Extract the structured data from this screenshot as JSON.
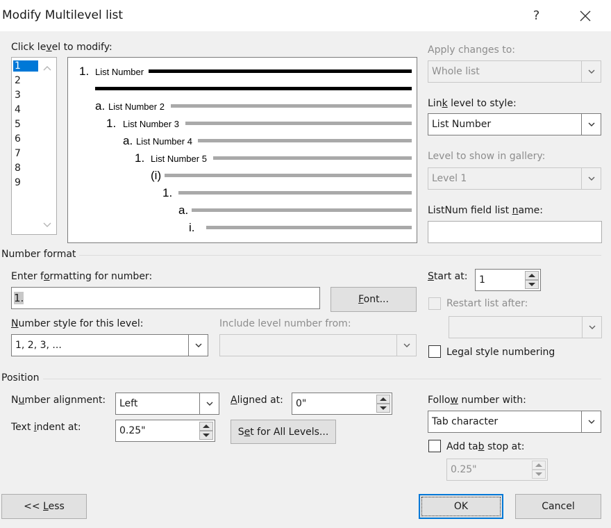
{
  "window": {
    "title": "Modify Multilevel list",
    "help": "?",
    "close": "✕"
  },
  "level_section": {
    "label": "Click level to modify:",
    "levels": [
      "1",
      "2",
      "3",
      "4",
      "5",
      "6",
      "7",
      "8",
      "9"
    ],
    "selected": "1"
  },
  "preview": {
    "items": [
      {
        "num": "1.",
        "text": "List Number"
      },
      {
        "num": "a.",
        "text": "List Number 2"
      },
      {
        "num": "1.",
        "text": "List Number 3"
      },
      {
        "num": "a.",
        "text": "List Number 4"
      },
      {
        "num": "1.",
        "text": "List Number 5"
      },
      {
        "num": "(i)",
        "text": ""
      },
      {
        "num": "1.",
        "text": ""
      },
      {
        "num": "a.",
        "text": ""
      },
      {
        "num": "i.",
        "text": ""
      }
    ]
  },
  "right_panel": {
    "apply_label": "Apply changes to:",
    "apply_value": "Whole list",
    "link_label": "Link level to style:",
    "link_value": "List Number",
    "gallery_label": "Level to show in gallery:",
    "gallery_value": "Level 1",
    "listnum_label": "ListNum field list name:",
    "listnum_value": ""
  },
  "number_format": {
    "section_label": "Number format",
    "enter_label": "Enter formatting for number:",
    "enter_value": "1.",
    "font_button": "Font...",
    "style_label": "Number style for this level:",
    "style_value": "1, 2, 3, ...",
    "include_label": "Include level number from:",
    "include_value": "",
    "start_label": "Start at:",
    "start_value": "1",
    "restart_label": "Restart list after:",
    "restart_value": "",
    "legal_label": "Legal style numbering"
  },
  "position": {
    "section_label": "Position",
    "alignment_label": "Number alignment:",
    "alignment_value": "Left",
    "aligned_at_label": "Aligned at:",
    "aligned_at_value": "0\"",
    "indent_label": "Text indent at:",
    "indent_value": "0.25\"",
    "set_all_button": "Set for All Levels...",
    "follow_label": "Follow number with:",
    "follow_value": "Tab character",
    "tab_stop_label": "Add tab stop at:",
    "tab_stop_value": "0.25\""
  },
  "footer": {
    "less_button": "<< Less",
    "ok_button": "OK",
    "cancel_button": "Cancel"
  },
  "colors": {
    "selection": "#0078d7",
    "ok_border": "#0078d7",
    "dialog_bg": "#f0f0f0"
  }
}
